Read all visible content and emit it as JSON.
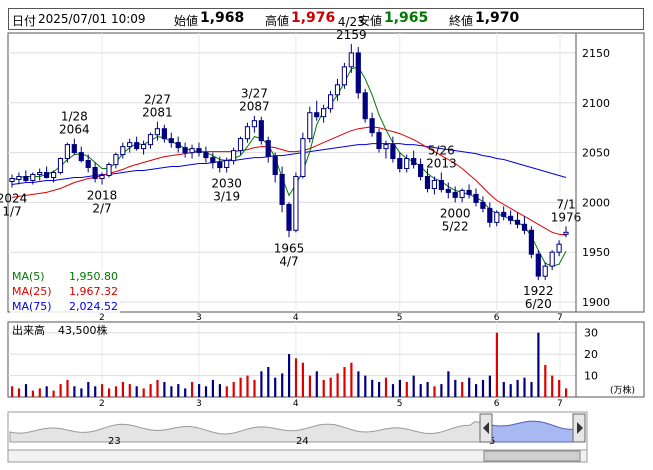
{
  "header": {
    "date_label": "日付",
    "datetime": "2025/07/01 10:09",
    "open_label": "始値",
    "open_value": "1,968",
    "high_label": "高値",
    "high_value": "1,976",
    "low_label": "安値",
    "low_value": "1,965",
    "close_label": "終値",
    "close_value": "1,970",
    "colors": {
      "high": "#cc0000",
      "low": "#007700",
      "close": "#000000",
      "open": "#000000"
    }
  },
  "chart_data": [
    {
      "type": "candlestick",
      "yticks": [
        1900,
        1950,
        2000,
        2050,
        2100,
        2150
      ],
      "ylim": [
        1890,
        2170
      ],
      "xticks": [
        "2",
        "3",
        "4",
        "5",
        "6",
        "7"
      ],
      "grid": true,
      "legend_position": "bottom-left",
      "ohlc": [
        [
          2021,
          2028,
          2015,
          2024
        ],
        [
          2023,
          2030,
          2018,
          2026
        ],
        [
          2026,
          2032,
          2020,
          2022
        ],
        [
          2022,
          2030,
          2018,
          2028
        ],
        [
          2028,
          2034,
          2022,
          2030
        ],
        [
          2030,
          2036,
          2024,
          2025
        ],
        [
          2025,
          2032,
          2020,
          2030
        ],
        [
          2030,
          2045,
          2028,
          2044
        ],
        [
          2044,
          2060,
          2040,
          2058
        ],
        [
          2058,
          2064,
          2048,
          2050
        ],
        [
          2050,
          2056,
          2040,
          2042
        ],
        [
          2042,
          2048,
          2030,
          2035
        ],
        [
          2035,
          2040,
          2020,
          2024
        ],
        [
          2024,
          2030,
          2018,
          2027
        ],
        [
          2027,
          2040,
          2025,
          2038
        ],
        [
          2038,
          2050,
          2034,
          2048
        ],
        [
          2048,
          2060,
          2044,
          2056
        ],
        [
          2056,
          2064,
          2050,
          2060
        ],
        [
          2060,
          2066,
          2052,
          2054
        ],
        [
          2054,
          2062,
          2048,
          2058
        ],
        [
          2058,
          2070,
          2054,
          2068
        ],
        [
          2068,
          2081,
          2062,
          2074
        ],
        [
          2074,
          2078,
          2060,
          2064
        ],
        [
          2064,
          2070,
          2055,
          2060
        ],
        [
          2060,
          2066,
          2050,
          2055
        ],
        [
          2055,
          2060,
          2045,
          2050
        ],
        [
          2050,
          2058,
          2044,
          2054
        ],
        [
          2054,
          2060,
          2046,
          2050
        ],
        [
          2050,
          2056,
          2040,
          2045
        ],
        [
          2045,
          2050,
          2034,
          2040
        ],
        [
          2040,
          2046,
          2030,
          2035
        ],
        [
          2035,
          2045,
          2030,
          2042
        ],
        [
          2042,
          2055,
          2038,
          2052
        ],
        [
          2052,
          2066,
          2048,
          2064
        ],
        [
          2064,
          2080,
          2060,
          2076
        ],
        [
          2076,
          2087,
          2070,
          2082
        ],
        [
          2082,
          2086,
          2058,
          2062
        ],
        [
          2062,
          2066,
          2040,
          2046
        ],
        [
          2046,
          2050,
          2020,
          2028
        ],
        [
          2028,
          2036,
          1990,
          1998
        ],
        [
          1998,
          2000,
          1965,
          1972
        ],
        [
          1972,
          2030,
          1970,
          2026
        ],
        [
          2026,
          2070,
          2024,
          2064
        ],
        [
          2064,
          2096,
          2060,
          2090
        ],
        [
          2090,
          2102,
          2082,
          2086
        ],
        [
          2086,
          2098,
          2080,
          2094
        ],
        [
          2094,
          2112,
          2090,
          2108
        ],
        [
          2108,
          2124,
          2102,
          2118
        ],
        [
          2118,
          2140,
          2114,
          2136
        ],
        [
          2136,
          2159,
          2130,
          2150
        ],
        [
          2150,
          2156,
          2104,
          2110
        ],
        [
          2110,
          2114,
          2080,
          2084
        ],
        [
          2084,
          2090,
          2066,
          2070
        ],
        [
          2070,
          2074,
          2050,
          2054
        ],
        [
          2054,
          2062,
          2044,
          2058
        ],
        [
          2058,
          2066,
          2040,
          2044
        ],
        [
          2044,
          2050,
          2030,
          2034
        ],
        [
          2034,
          2048,
          2030,
          2044
        ],
        [
          2044,
          2052,
          2034,
          2038
        ],
        [
          2038,
          2044,
          2022,
          2026
        ],
        [
          2026,
          2034,
          2010,
          2014
        ],
        [
          2014,
          2026,
          2008,
          2022
        ],
        [
          2022,
          2030,
          2010,
          2013
        ],
        [
          2013,
          2020,
          2004,
          2010
        ],
        [
          2010,
          2016,
          2000,
          2005
        ],
        [
          2005,
          2014,
          2000,
          2012
        ],
        [
          2012,
          2018,
          2004,
          2008
        ],
        [
          2008,
          2014,
          1996,
          2000
        ],
        [
          2000,
          2006,
          1990,
          1994
        ],
        [
          1994,
          2000,
          1975,
          1980
        ],
        [
          1980,
          1992,
          1976,
          1990
        ],
        [
          1990,
          1996,
          1982,
          1986
        ],
        [
          1986,
          1992,
          1978,
          1982
        ],
        [
          1982,
          1990,
          1974,
          1978
        ],
        [
          1978,
          1986,
          1968,
          1972
        ],
        [
          1972,
          1976,
          1944,
          1948
        ],
        [
          1948,
          1952,
          1922,
          1926
        ],
        [
          1926,
          1940,
          1922,
          1936
        ],
        [
          1936,
          1952,
          1932,
          1950
        ],
        [
          1950,
          1962,
          1946,
          1958
        ],
        [
          1968,
          1976,
          1965,
          1970
        ]
      ],
      "ma5": [
        2022,
        2025,
        2026,
        2026,
        2026,
        2028,
        2031,
        2036,
        2043,
        2048,
        2049,
        2046,
        2040,
        2034,
        2034,
        2040,
        2049,
        2055,
        2059,
        2058,
        2062,
        2066,
        2065,
        2061,
        2058,
        2054,
        2052,
        2051,
        2050,
        2047,
        2043,
        2042,
        2044,
        2047,
        2056,
        2066,
        2064,
        2058,
        2045,
        2025,
        2007,
        2018,
        2031,
        2051,
        2078,
        2092,
        2098,
        2108,
        2120,
        2134,
        2136,
        2124,
        2108,
        2088,
        2073,
        2060,
        2050,
        2044,
        2041,
        2036,
        2029,
        2024,
        2021,
        2016,
        2012,
        2010,
        2008,
        2005,
        2001,
        1993,
        1989,
        1986,
        1983,
        1980,
        1976,
        1966,
        1952,
        1939,
        1936,
        1938,
        1951
      ],
      "ma25": [
        2005,
        2006,
        2007,
        2008,
        2009,
        2010,
        2012,
        2014,
        2017,
        2020,
        2022,
        2024,
        2025,
        2027,
        2029,
        2031,
        2033,
        2036,
        2038,
        2040,
        2042,
        2044,
        2046,
        2047,
        2048,
        2049,
        2050,
        2051,
        2051,
        2051,
        2051,
        2051,
        2051,
        2052,
        2053,
        2055,
        2056,
        2056,
        2055,
        2053,
        2051,
        2051,
        2052,
        2054,
        2057,
        2060,
        2063,
        2066,
        2069,
        2072,
        2074,
        2075,
        2076,
        2075,
        2073,
        2071,
        2069,
        2066,
        2063,
        2059,
        2055,
        2051,
        2047,
        2043,
        2039,
        2034,
        2028,
        2022,
        2015,
        2008,
        2002,
        1998,
        1994,
        1990,
        1986,
        1982,
        1978,
        1974,
        1970,
        1968,
        1967
      ],
      "ma75": [
        2018,
        2019,
        2020,
        2020,
        2021,
        2022,
        2022,
        2023,
        2024,
        2025,
        2025,
        2026,
        2027,
        2028,
        2028,
        2029,
        2030,
        2031,
        2032,
        2032,
        2033,
        2034,
        2035,
        2036,
        2036,
        2037,
        2038,
        2039,
        2039,
        2040,
        2041,
        2042,
        2042,
        2043,
        2044,
        2045,
        2045,
        2046,
        2047,
        2047,
        2048,
        2049,
        2050,
        2051,
        2052,
        2053,
        2054,
        2055,
        2056,
        2057,
        2058,
        2058,
        2059,
        2059,
        2059,
        2059,
        2059,
        2058,
        2058,
        2057,
        2056,
        2055,
        2054,
        2053,
        2052,
        2051,
        2050,
        2049,
        2047,
        2046,
        2044,
        2043,
        2041,
        2039,
        2037,
        2035,
        2033,
        2031,
        2029,
        2027,
        2025
      ],
      "annotations": [
        {
          "label": "2024",
          "sub": "1/7",
          "idx": 0,
          "pos": "below"
        },
        {
          "label": "1/28",
          "sub": "2064",
          "idx": 9,
          "pos": "above"
        },
        {
          "label": "2018",
          "sub": "2/7",
          "idx": 13,
          "pos": "below"
        },
        {
          "label": "2/27",
          "sub": "2081",
          "idx": 21,
          "pos": "above"
        },
        {
          "label": "2030",
          "sub": "3/19",
          "idx": 31,
          "pos": "below"
        },
        {
          "label": "3/27",
          "sub": "2087",
          "idx": 35,
          "pos": "above"
        },
        {
          "label": "1965",
          "sub": "4/7",
          "idx": 40,
          "pos": "below"
        },
        {
          "label": "4/23",
          "sub": "2159",
          "idx": 49,
          "pos": "above"
        },
        {
          "label": "5/26",
          "sub": "2013",
          "idx": 62,
          "pos": "above"
        },
        {
          "label": "2000",
          "sub": "5/22",
          "idx": 64,
          "pos": "below"
        },
        {
          "label": "1922",
          "sub": "6/20",
          "idx": 76,
          "pos": "below"
        },
        {
          "label": "7/1",
          "sub": "1976",
          "idx": 80,
          "pos": "above"
        }
      ],
      "legend": [
        {
          "name": "MA(5)",
          "value": "1,950.80",
          "color": "#007700"
        },
        {
          "name": "MA(25)",
          "value": "1,967.32",
          "color": "#dd0000"
        },
        {
          "name": "MA(75)",
          "value": "2,024.52",
          "color": "#0000dd"
        }
      ],
      "colors": {
        "up_fill": "#ffffff",
        "down_fill": "#000080",
        "outline": "#000080"
      }
    },
    {
      "type": "bar",
      "title_label": "出来高",
      "title_value": "43,500株",
      "unit_label": "(万株)",
      "yticks": [
        10,
        20,
        30
      ],
      "ylim": [
        0,
        35
      ],
      "values": [
        5,
        4,
        6,
        3,
        4,
        5,
        3,
        6,
        8,
        5,
        4,
        7,
        5,
        6,
        4,
        5,
        7,
        6,
        5,
        4,
        6,
        8,
        7,
        5,
        6,
        4,
        7,
        6,
        5,
        8,
        6,
        5,
        7,
        9,
        10,
        8,
        12,
        14,
        9,
        11,
        20,
        18,
        16,
        10,
        12,
        8,
        9,
        11,
        14,
        16,
        12,
        10,
        8,
        7,
        9,
        6,
        8,
        7,
        10,
        6,
        7,
        5,
        6,
        12,
        8,
        7,
        9,
        6,
        8,
        10,
        30,
        7,
        6,
        8,
        9,
        7,
        30,
        15,
        10,
        8,
        4
      ],
      "colors": {
        "down": "#000080",
        "up": "#dd0000"
      }
    },
    {
      "type": "area",
      "labels": [
        "23",
        "24",
        "5"
      ]
    }
  ]
}
